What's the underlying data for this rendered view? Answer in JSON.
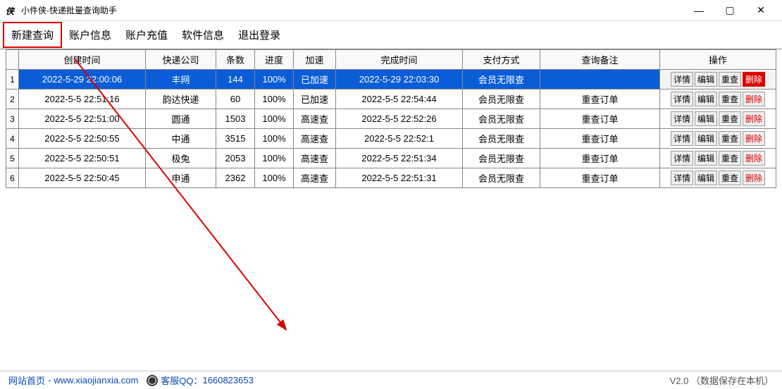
{
  "window": {
    "title": "小件侠-快递批量查询助手",
    "icon_text": "侠"
  },
  "menu": {
    "items": [
      {
        "label": "新建查询",
        "highlight": true
      },
      {
        "label": "账户信息"
      },
      {
        "label": "账户充值"
      },
      {
        "label": "软件信息"
      },
      {
        "label": "退出登录"
      }
    ]
  },
  "table": {
    "headers": {
      "create_time": "创建时间",
      "company": "快递公司",
      "count": "条数",
      "progress": "进度",
      "accel": "加速",
      "finish_time": "完成时间",
      "pay_method": "支付方式",
      "note": "查询备注",
      "ops": "操作"
    },
    "op_labels": {
      "detail": "详情",
      "edit": "编辑",
      "recheck": "重查",
      "delete": "删除"
    },
    "rows": [
      {
        "n": "1",
        "ctime": "2022-5-29 22:00:06",
        "comp": "丰网",
        "cnt": "144",
        "prog": "100%",
        "acc": "已加速",
        "ftime": "2022-5-29 22:03:30",
        "pay": "会员无限查",
        "note": "",
        "sel": true
      },
      {
        "n": "2",
        "ctime": "2022-5-5 22:51:16",
        "comp": "韵达快递",
        "cnt": "60",
        "prog": "100%",
        "acc": "已加速",
        "ftime": "2022-5-5 22:54:44",
        "pay": "会员无限查",
        "note": "重查订单"
      },
      {
        "n": "3",
        "ctime": "2022-5-5 22:51:00",
        "comp": "圆通",
        "cnt": "1503",
        "prog": "100%",
        "acc": "高速查",
        "ftime": "2022-5-5 22:52:26",
        "pay": "会员无限查",
        "note": "重查订单"
      },
      {
        "n": "4",
        "ctime": "2022-5-5 22:50:55",
        "comp": "中通",
        "cnt": "3515",
        "prog": "100%",
        "acc": "高速查",
        "ftime": "2022-5-5 22:52:1",
        "pay": "会员无限查",
        "note": "重查订单"
      },
      {
        "n": "5",
        "ctime": "2022-5-5 22:50:51",
        "comp": "极兔",
        "cnt": "2053",
        "prog": "100%",
        "acc": "高速查",
        "ftime": "2022-5-5 22:51:34",
        "pay": "会员无限查",
        "note": "重查订单"
      },
      {
        "n": "6",
        "ctime": "2022-5-5 22:50:45",
        "comp": "申通",
        "cnt": "2362",
        "prog": "100%",
        "acc": "高速查",
        "ftime": "2022-5-5 22:51:31",
        "pay": "会员无限查",
        "note": "重查订单"
      }
    ]
  },
  "status": {
    "site_label": "网站首页",
    "site_url": "www.xiaojianxia.com",
    "qq_label": "客服QQ：",
    "qq_num": "1660823653",
    "version": "V2.0 （数据保存在本机）"
  }
}
